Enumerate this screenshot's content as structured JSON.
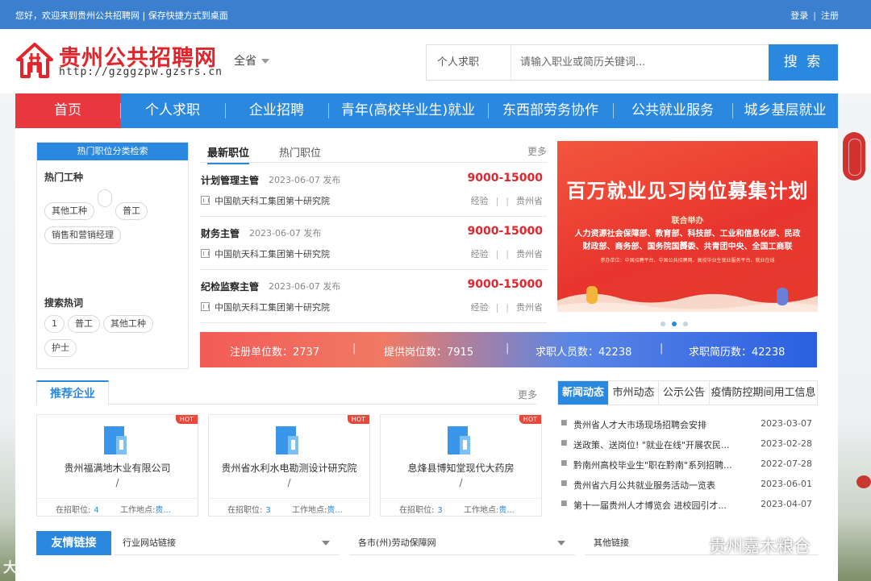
{
  "topbar": {
    "welcome": "您好，欢迎来到贵州公共招聘网 | 保存快捷方式到桌面",
    "login": "登录",
    "separator": "|",
    "register": "注册"
  },
  "header": {
    "site_name": "贵州公共招聘网",
    "site_url": "http://gzggzpw.gzsrs.cn",
    "region": "全省",
    "search_type": "个人求职",
    "search_placeholder": "请输入职业或简历关键词...",
    "search_button": "搜 索"
  },
  "nav": {
    "items": [
      "首页",
      "个人求职",
      "企业招聘",
      "青年(高校毕业生)就业",
      "东西部劳务协作",
      "公共就业服务",
      "城乡基层就业"
    ]
  },
  "categories": {
    "caption": "热门职位分类检索",
    "hot_types_title": "热门工种",
    "hot_types": [
      "其他工种",
      "",
      "普工",
      "销售和营销经理"
    ],
    "hot_search_title": "搜索热词",
    "hot_search": [
      "1",
      "普工",
      "其他工种",
      "护士"
    ]
  },
  "jobs": {
    "tab_latest": "最新职位",
    "tab_hot": "热门职位",
    "more": "更多",
    "list": [
      {
        "title": "计划管理主管",
        "date": "2023-06-07 发布",
        "salary": "9000-15000",
        "org": "中国航天科工集团第十研究院",
        "exp": "经验",
        "bar1": "|",
        "bar2": "|",
        "region": "贵州省"
      },
      {
        "title": "财务主管",
        "date": "2023-06-07 发布",
        "salary": "9000-15000",
        "org": "中国航天科工集团第十研究院",
        "exp": "经验",
        "bar1": "|",
        "bar2": "|",
        "region": "贵州省"
      },
      {
        "title": "纪检监察主管",
        "date": "2023-06-07 发布",
        "salary": "9000-15000",
        "org": "中国航天科工集团第十研究院",
        "exp": "经验",
        "bar1": "|",
        "bar2": "|",
        "region": "贵州省"
      }
    ]
  },
  "banner": {
    "title": "百万就业见习岗位募集计划",
    "subtitle": "联合举办",
    "line1": "人力资源社会保障部、教育部、科技部、工业和信息化部、民政部、",
    "line2": "财政部、商务部、国务院国资委、共青团中央、全国工商联",
    "footer": "参办单位：中国招聘平台、中国公共招聘网、高校毕业生就业服务平台、就业在线"
  },
  "stats": {
    "items": [
      {
        "label": "注册单位数：2737"
      },
      {
        "label": "提供岗位数：7915"
      },
      {
        "label": "求职人员数：42238"
      },
      {
        "label": "求职简历数：42238"
      }
    ],
    "bar": "|"
  },
  "companies": {
    "caption": "推荐企业",
    "more": "更多",
    "hot_label": "HOT",
    "list": [
      {
        "name": "贵州福满地木业有限公司",
        "slash": "/",
        "jobs_label": "在招职位:",
        "jobs": "4",
        "loc_label": "工作地点:",
        "loc": "贵..."
      },
      {
        "name": "贵州省水利水电勘测设计研究院",
        "slash": "/",
        "jobs_label": "在招职位:",
        "jobs": "3",
        "loc_label": "工作地点:",
        "loc": "贵..."
      },
      {
        "name": "息烽县博知堂现代大药房",
        "slash": "/",
        "jobs_label": "在招职位:",
        "jobs": "3",
        "loc_label": "工作地点:",
        "loc": "贵..."
      }
    ]
  },
  "news": {
    "tabs": [
      "新闻动态",
      "市州动态",
      "公示公告",
      "疫情防控期间用工信息"
    ],
    "list": [
      {
        "title": "贵州省人才大市场现场招聘会安排",
        "date": "2023-03-07"
      },
      {
        "title": "送政策、送岗位! \"就业在线\"开展农民...",
        "date": "2023-02-28"
      },
      {
        "title": "黔南州高校毕业生\"职在黔南\"系列招聘...",
        "date": "2022-07-28"
      },
      {
        "title": "贵州省六月公共就业服务活动一览表",
        "date": "2023-06-01"
      },
      {
        "title": "第十一届贵州人才博览会 进校园引才...",
        "date": "2023-04-07"
      }
    ]
  },
  "links": {
    "caption": "友情链接",
    "selects": [
      "行业网站链接",
      "各市(州)劳动保障网",
      "其他链接"
    ]
  },
  "watermarks": {
    "left": "大数跨境",
    "right": "贵州嘉木粮仓"
  },
  "colors": {
    "primary": "#2b88df",
    "accent_red": "#e8383d",
    "salary_red": "#e0262c"
  }
}
